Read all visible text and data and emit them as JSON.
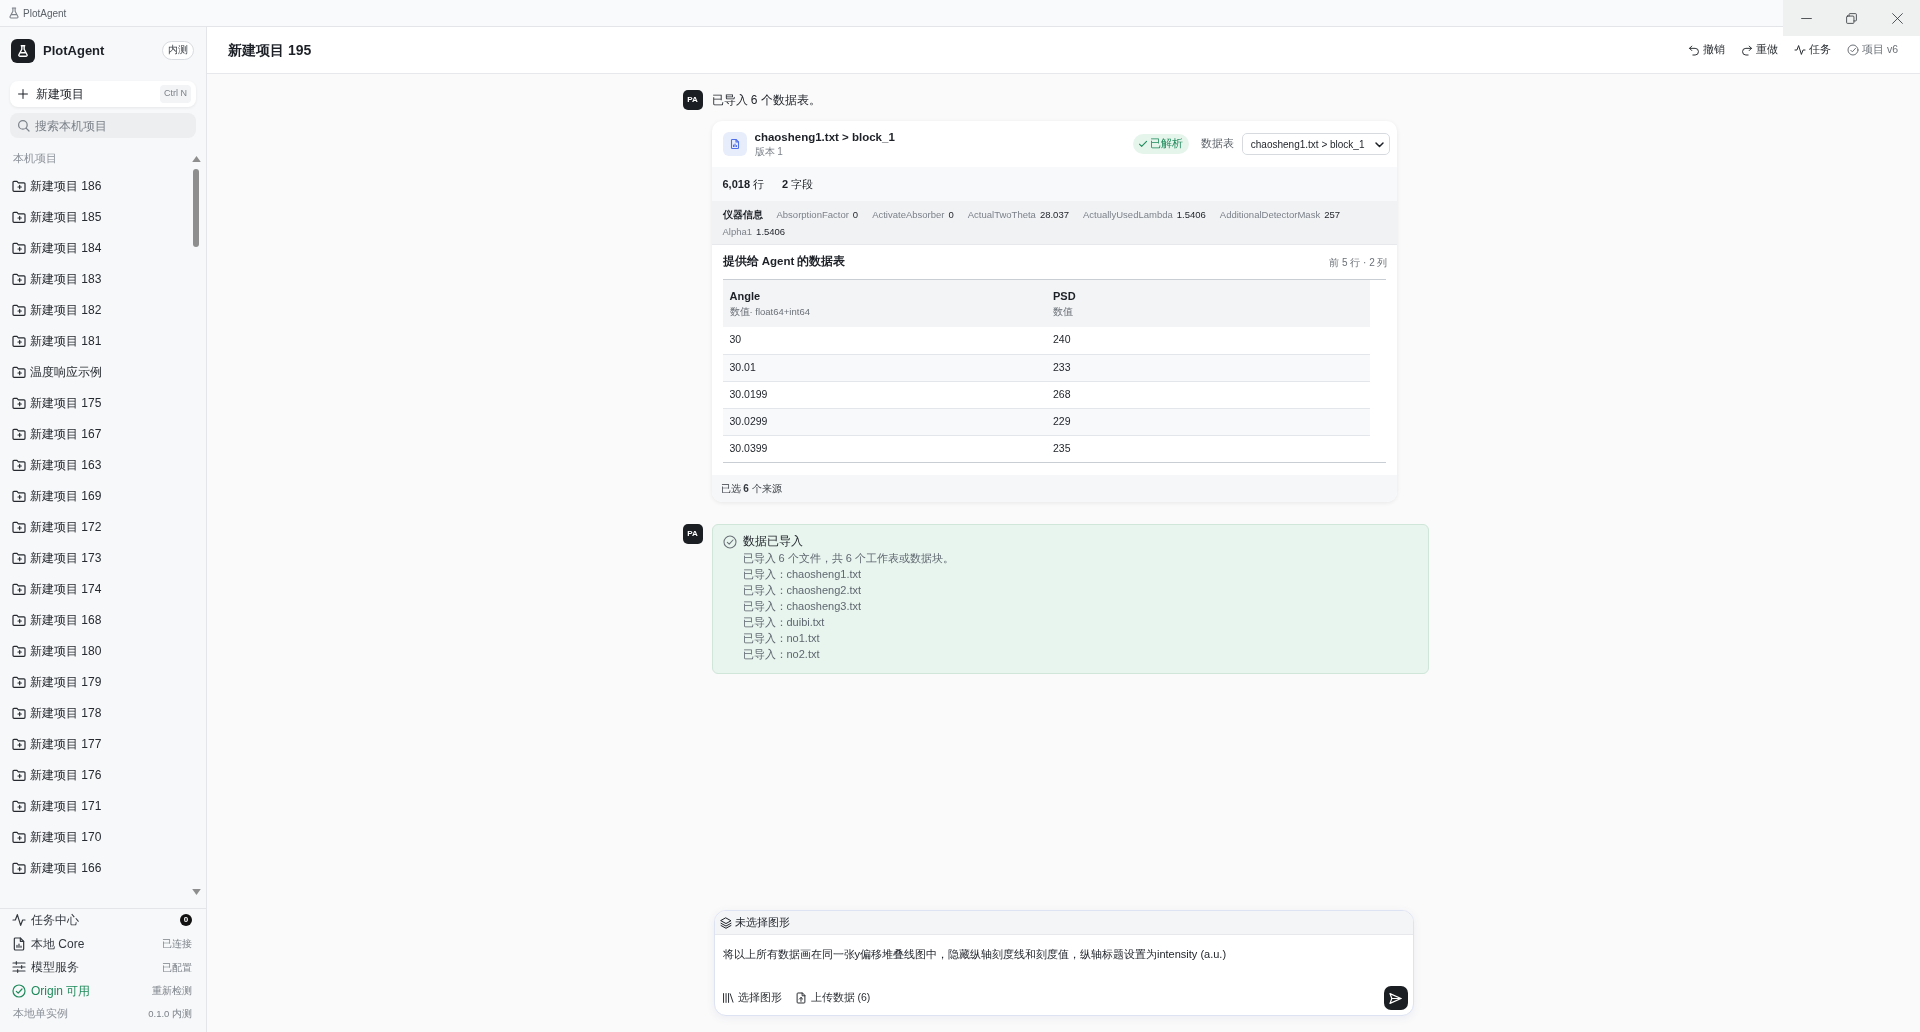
{
  "window": {
    "title": "PlotAgent"
  },
  "sidebar": {
    "brand": "PlotAgent",
    "badge": "内测",
    "new_project": {
      "label": "新建项目",
      "shortcut": "Ctrl N"
    },
    "search": {
      "placeholder": "搜索本机项目"
    },
    "section": "本机项目",
    "projects": [
      {
        "label": "新建项目 186",
        "selected": false
      },
      {
        "label": "新建项目 185",
        "selected": false
      },
      {
        "label": "新建项目 184",
        "selected": false
      },
      {
        "label": "新建项目 183",
        "selected": false
      },
      {
        "label": "新建项目 182",
        "selected": false
      },
      {
        "label": "新建项目 181",
        "selected": false
      },
      {
        "label": "温度响应示例",
        "selected": false
      },
      {
        "label": "新建项目 175",
        "selected": false
      },
      {
        "label": "新建项目 167",
        "selected": false
      },
      {
        "label": "新建项目 163",
        "selected": false
      },
      {
        "label": "新建项目 169",
        "selected": false
      },
      {
        "label": "新建项目 172",
        "selected": false
      },
      {
        "label": "新建项目 173",
        "selected": false
      },
      {
        "label": "新建项目 174",
        "selected": false
      },
      {
        "label": "新建项目 168",
        "selected": false
      },
      {
        "label": "新建项目 180",
        "selected": false
      },
      {
        "label": "新建项目 179",
        "selected": false
      },
      {
        "label": "新建项目 178",
        "selected": false
      },
      {
        "label": "新建项目 177",
        "selected": false
      },
      {
        "label": "新建项目 176",
        "selected": false
      },
      {
        "label": "新建项目 171",
        "selected": false
      },
      {
        "label": "新建项目 170",
        "selected": false
      },
      {
        "label": "新建项目 166",
        "selected": false
      }
    ],
    "status": [
      {
        "kind": "tasks",
        "label": "任务中心",
        "count": "0"
      },
      {
        "kind": "core",
        "label": "本地 Core",
        "value": "已连接"
      },
      {
        "kind": "model",
        "label": "模型服务",
        "value": "已配置"
      },
      {
        "kind": "origin",
        "label": "Origin 可用",
        "value": "重新检测"
      }
    ],
    "instance": {
      "label": "本地单实例",
      "version": "0.1.0 内测"
    }
  },
  "header": {
    "title": "新建项目 195",
    "actions": [
      {
        "kind": "undo",
        "label": "撤销"
      },
      {
        "kind": "redo",
        "label": "重做"
      },
      {
        "kind": "tasks",
        "label": "任务"
      },
      {
        "kind": "version",
        "label": "项目 v6"
      }
    ]
  },
  "messages": [
    {
      "kind": "dataset",
      "avatar": "PA",
      "text": "已导入 6 个数据表。",
      "card": {
        "file": "chaosheng1.txt > block_1",
        "version": "版本 1",
        "status": "已解析",
        "table_label": "数据表",
        "table_value": "chaosheng1.txt > block_1",
        "stats": [
          "**6,018** 行",
          "**2** 字段"
        ],
        "meta_label": "仪器信息",
        "meta": [
          {
            "key": "AbsorptionFactor",
            "value": "0"
          },
          {
            "key": "ActivateAbsorber",
            "value": "0"
          },
          {
            "key": "ActualTwoTheta",
            "value": "28.037"
          },
          {
            "key": "ActuallyUsedLambda",
            "value": "1.5406"
          },
          {
            "key": "AdditionalDetectorMask",
            "value": "257"
          },
          {
            "key": "Alpha1",
            "value": "1.5406"
          }
        ],
        "preview_title": "提供给 Agent 的数据表",
        "preview_info": "前 5 行 · 2 列",
        "columns": [
          {
            "name": "Angle",
            "type": "数值· float64+int64"
          },
          {
            "name": "PSD",
            "type": "数值"
          }
        ],
        "rows": [
          [
            "30",
            "240"
          ],
          [
            "30.01",
            "233"
          ],
          [
            "30.0199",
            "268"
          ],
          [
            "30.0299",
            "229"
          ],
          [
            "30.0399",
            "235"
          ]
        ],
        "footer": "已选 **6** 个来源"
      }
    },
    {
      "kind": "notice",
      "avatar": "PA",
      "title": "数据已导入",
      "lines": [
        "已导入 6 个文件，共 6 个工作表或数据块。",
        "已导入：chaosheng1.txt",
        "已导入：chaosheng2.txt",
        "已导入：chaosheng3.txt",
        "已导入：duibi.txt",
        "已导入：no1.txt",
        "已导入：no2.txt"
      ]
    }
  ],
  "composer": {
    "context": "未选择图形",
    "value": "将以上所有数据画在同一张y偏移堆叠线图中，隐藏纵轴刻度线和刻度值，纵轴标题设置为intensity (a.u.)",
    "tools": [
      {
        "kind": "chart",
        "label": "选择图形"
      },
      {
        "kind": "upload",
        "label": "上传数据 (6)"
      }
    ]
  }
}
